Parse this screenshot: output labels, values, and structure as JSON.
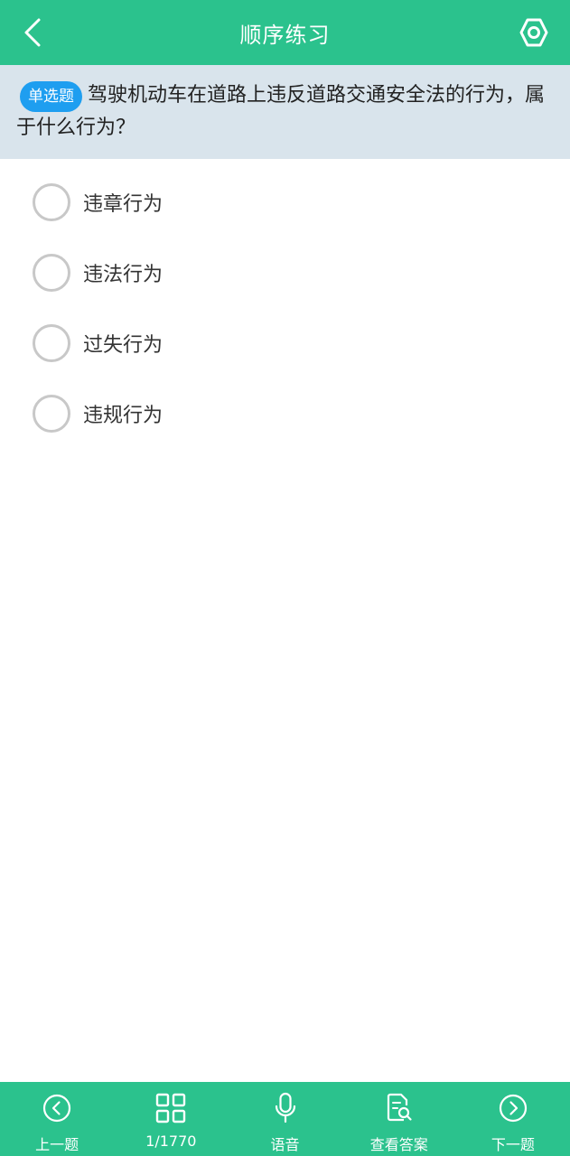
{
  "header": {
    "title": "顺序练习",
    "back_icon": "chevron-left-icon",
    "settings_icon": "hexagon-gear-icon"
  },
  "question": {
    "type_badge": "单选题",
    "text": "驾驶机动车在道路上违反道路交通安全法的行为，属于什么行为？"
  },
  "options": [
    {
      "label": "违章行为"
    },
    {
      "label": "违法行为"
    },
    {
      "label": "过失行为"
    },
    {
      "label": "违规行为"
    }
  ],
  "bottom_nav": {
    "prev": {
      "label": "上一题",
      "icon": "circle-chevron-left-icon"
    },
    "progress": {
      "label": "1/1770",
      "icon": "grid-icon"
    },
    "voice": {
      "label": "语音",
      "icon": "microphone-icon"
    },
    "answer": {
      "label": "查看答案",
      "icon": "document-search-icon"
    },
    "next": {
      "label": "下一题",
      "icon": "circle-chevron-right-icon"
    }
  },
  "colors": {
    "accent": "#2bc28d",
    "badge": "#1e9ef0",
    "question_bg": "#d9e4ec"
  }
}
